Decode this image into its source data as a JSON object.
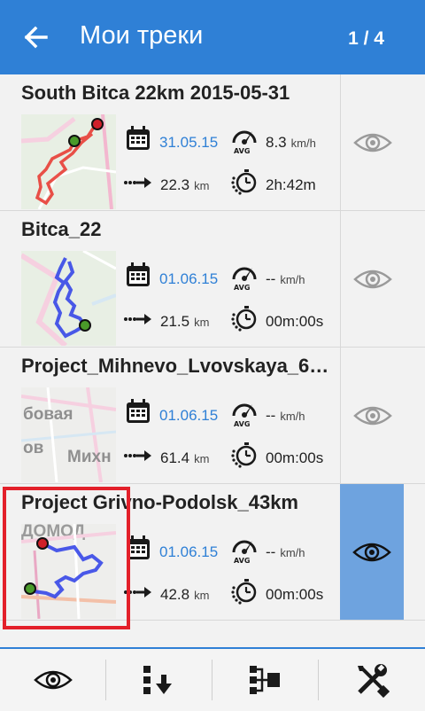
{
  "appbar": {
    "title": "Мои треки",
    "page_indicator": "1 / 4",
    "color": "#2f80d6",
    "back_icon": "arrow-left-icon"
  },
  "tracks": [
    {
      "name": "South Bitca 22km 2015-05-31",
      "date": "31.05.15",
      "speed": "8.3",
      "speed_unit": "km/h",
      "distance": "22.3",
      "distance_unit": "km",
      "duration": "2h:42m",
      "visible": false
    },
    {
      "name": "Bitca_22",
      "date": "01.06.15",
      "speed": "--",
      "speed_unit": "km/h",
      "distance": "21.5",
      "distance_unit": "km",
      "duration": "00m:00s",
      "visible": false
    },
    {
      "name": "Project_Mihnevo_Lvovskaya_6…",
      "date": "01.06.15",
      "speed": "--",
      "speed_unit": "km/h",
      "distance": "61.4",
      "distance_unit": "km",
      "duration": "00m:00s",
      "visible": false,
      "map_labels": [
        "бовая",
        "ов",
        "Михн"
      ]
    },
    {
      "name": "Project Grivno-Podolsk_43km",
      "date": "01.06.15",
      "speed": "--",
      "speed_unit": "km/h",
      "distance": "42.8",
      "distance_unit": "km",
      "duration": "00m:00s",
      "visible": true,
      "map_labels": [
        "ДОМОД"
      ]
    }
  ],
  "stat_icons": {
    "date": "calendar-icon",
    "speed": "avg-speedometer-icon",
    "avg_label": "AVG",
    "distance": "distance-arrow-icon",
    "duration": "stopwatch-icon"
  },
  "toolbar": {
    "items": [
      "show-all-eye-icon",
      "sort-icon",
      "merge-tracks-icon",
      "tools-icon"
    ]
  },
  "colors": {
    "accent": "#2f80d6",
    "selected": "#6ea3df",
    "highlight": "#e3202a",
    "track_red": "#e8332b",
    "track_blue": "#2b3de8"
  }
}
